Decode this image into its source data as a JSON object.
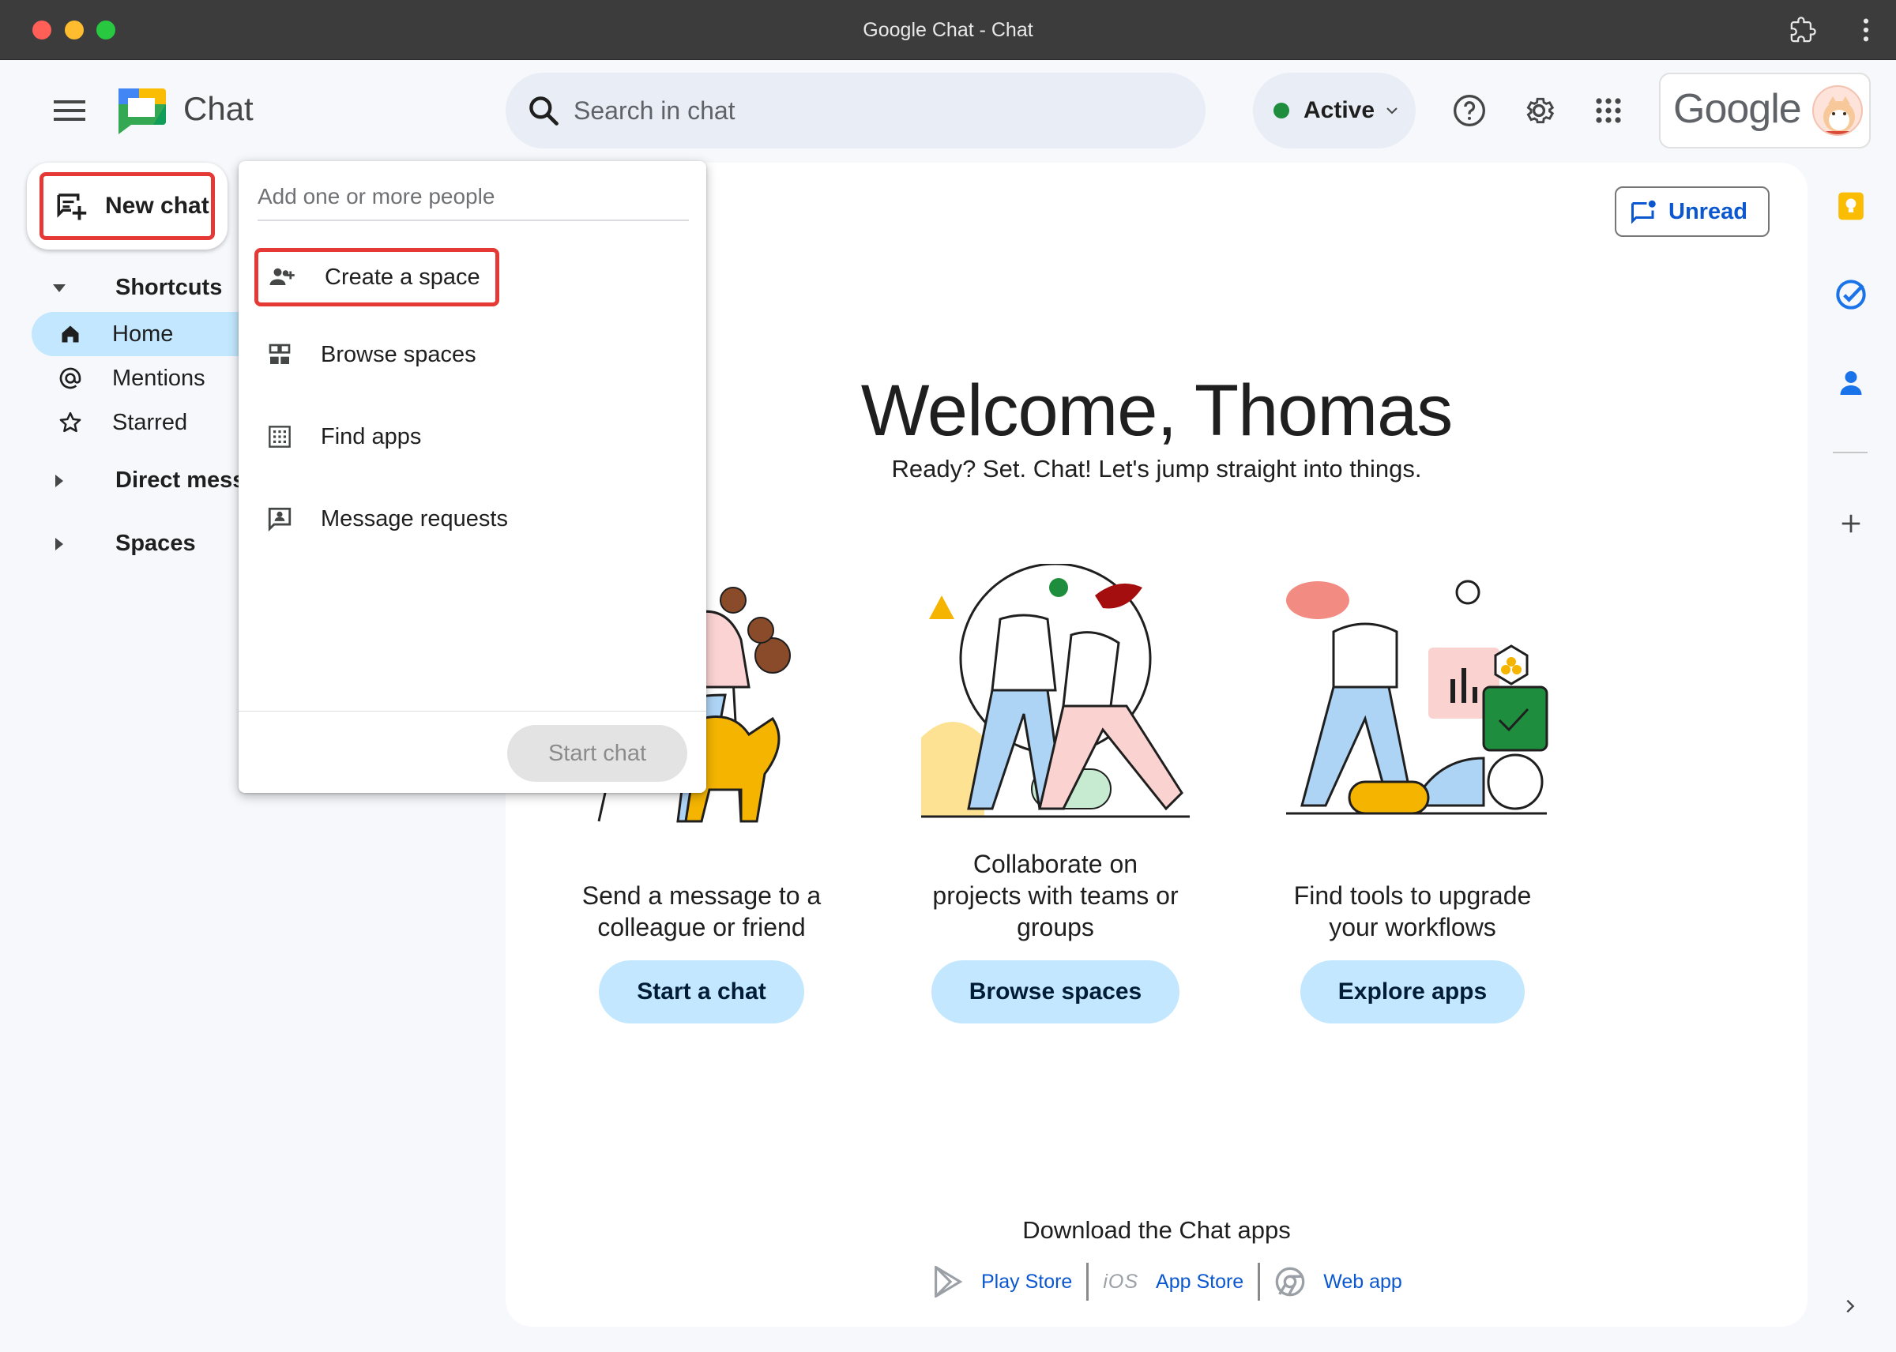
{
  "window": {
    "title": "Google Chat - Chat"
  },
  "header": {
    "app_name": "Chat",
    "search": {
      "placeholder": "Search in chat",
      "value": ""
    },
    "status": {
      "label": "Active",
      "color": "#1e8e3e"
    },
    "account_brand": "Google"
  },
  "nav": {
    "new_chat_label": "New chat",
    "shortcuts_label": "Shortcuts",
    "items": [
      {
        "label": "Home",
        "icon": "home-icon",
        "active": true
      },
      {
        "label": "Mentions",
        "icon": "at-sign-icon",
        "active": false
      },
      {
        "label": "Starred",
        "icon": "star-icon",
        "active": false
      }
    ],
    "direct_messages_label": "Direct mess",
    "spaces_label": "Spaces"
  },
  "dropdown": {
    "input_placeholder": "Add one or more people",
    "items": [
      {
        "label": "Create a space",
        "icon": "group-add-icon"
      },
      {
        "label": "Browse spaces",
        "icon": "browse-grid-icon"
      },
      {
        "label": "Find apps",
        "icon": "apps-grid-icon"
      },
      {
        "label": "Message requests",
        "icon": "message-person-icon"
      }
    ],
    "start_chat_label": "Start chat"
  },
  "main": {
    "unread_label": "Unread",
    "welcome_title": "Welcome, Thomas",
    "welcome_subtitle": "Ready? Set. Chat! Let's jump straight into things.",
    "cards": [
      {
        "text_line1": "Send a message to a",
        "text_line2": "colleague or friend",
        "text_line3": "",
        "button": "Start a chat"
      },
      {
        "text_line1": "Collaborate on",
        "text_line2": "projects with teams or",
        "text_line3": "groups",
        "button": "Browse spaces"
      },
      {
        "text_line1": "Find tools to upgrade",
        "text_line2": "your workflows",
        "text_line3": "",
        "button": "Explore apps"
      }
    ],
    "download": {
      "title": "Download the Chat apps",
      "play_store": "Play Store",
      "ios_label": "iOS",
      "app_store": "App Store",
      "web_app": "Web app"
    }
  },
  "colors": {
    "accent_blue": "#0b57d0",
    "highlight_red": "#e53935",
    "active_nav_bg": "#c2e7ff"
  }
}
